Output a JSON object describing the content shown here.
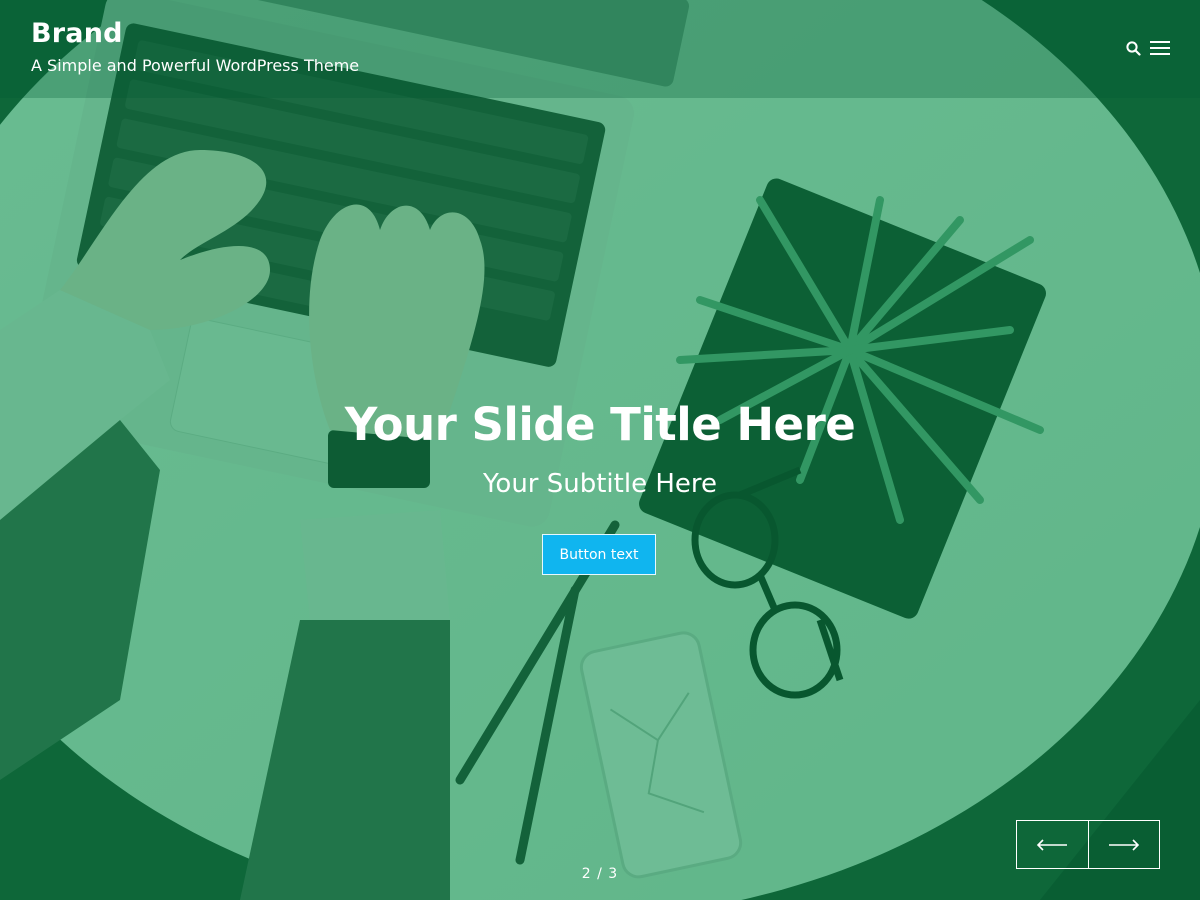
{
  "header": {
    "brand": "Brand",
    "tagline": "A Simple and Powerful WordPress Theme",
    "search_icon": "search-icon",
    "menu_icon": "hamburger-menu-icon"
  },
  "slide": {
    "title": "Your Slide Title Here",
    "subtitle": "Your Subtitle Here",
    "button_label": "Button text",
    "current": 2,
    "total": 3,
    "counter": "2 / 3"
  },
  "nav": {
    "prev_icon": "arrow-left-icon",
    "next_icon": "arrow-right-icon"
  },
  "colors": {
    "overlay": "#008c46",
    "button": "#10b5ef",
    "text": "#ffffff"
  }
}
